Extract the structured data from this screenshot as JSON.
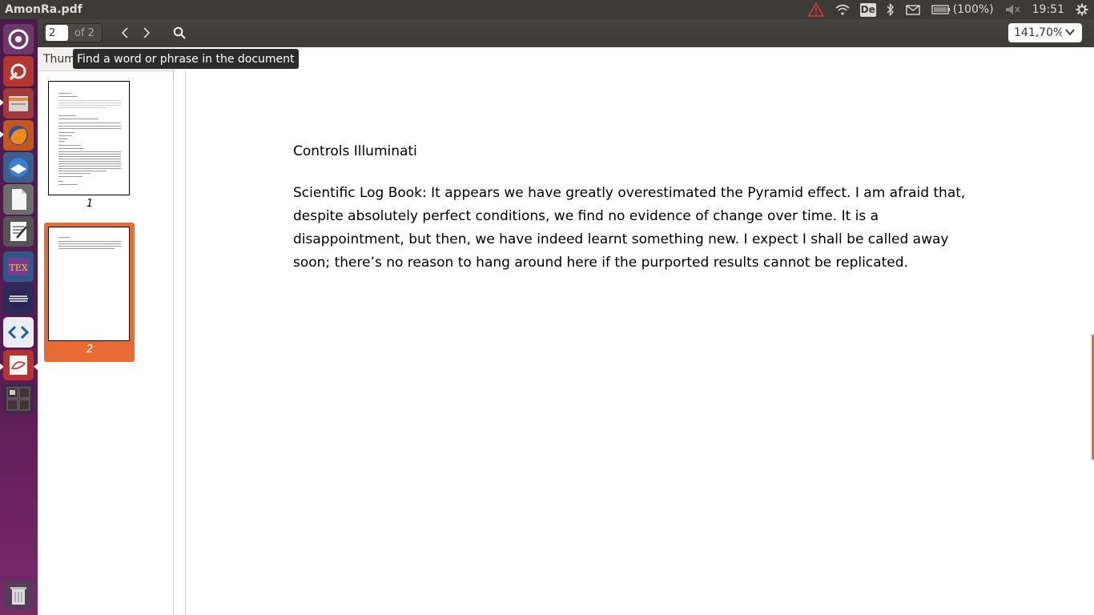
{
  "window": {
    "title": "AmonRa.pdf"
  },
  "indicators": {
    "keyboard": "De",
    "battery": "(100%)",
    "clock": "19:51"
  },
  "toolbar": {
    "page_current": "2",
    "page_total": "of 2",
    "zoom": "141,70%",
    "search_tooltip": "Find a word or phrase in the document"
  },
  "sidebar": {
    "header": "Thum",
    "thumbnails": [
      {
        "label": "1"
      },
      {
        "label": "2"
      }
    ]
  },
  "document": {
    "heading": "Controls Illuminati",
    "body": "Scientific Log Book: It appears we have greatly overestimated the Pyramid effect. I am afraid that, despite absolutely perfect conditions, we find no evidence of change over time. It is a disappointment, but then, we have indeed learnt something new. I expect I shall be called away soon; there’s no reason to hang around here if the purported results cannot be replicated."
  },
  "launcher": {
    "items": [
      "dash-icon",
      "settings-icon",
      "file-manager-icon",
      "firefox-icon",
      "thunderbird-icon",
      "libreoffice-icon",
      "text-editor-icon",
      "texmaker-icon",
      "eclipse-icon",
      "code-editor-icon",
      "document-viewer-icon",
      "workspace-switcher-icon",
      "trash-icon"
    ]
  },
  "colors": {
    "accent": "#e86a35",
    "panel": "#3c3b37",
    "launcher": "#4b1a4c"
  }
}
